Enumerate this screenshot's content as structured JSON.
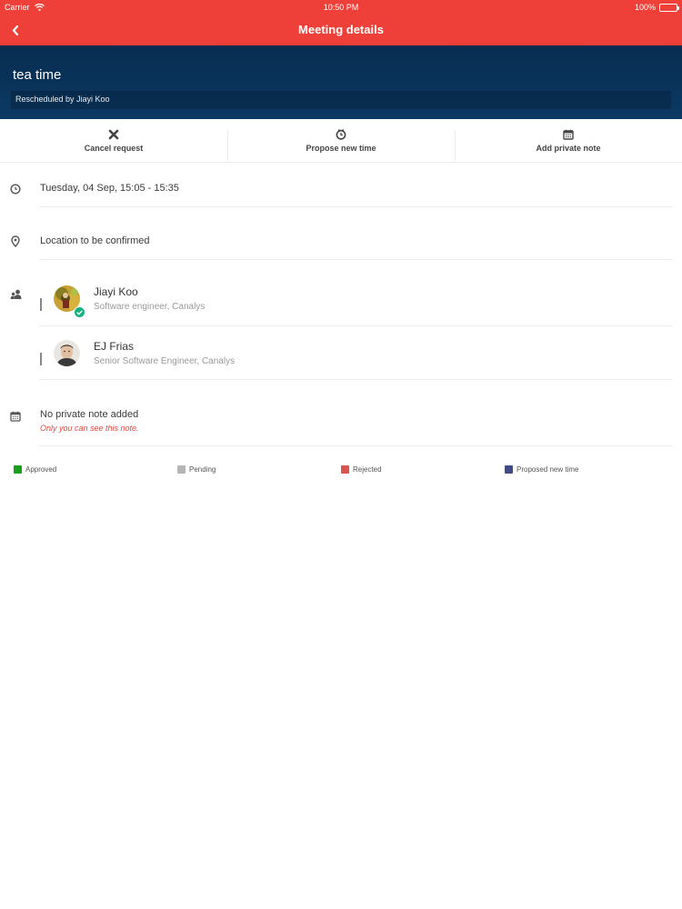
{
  "status_bar": {
    "carrier": "Carrier",
    "time": "10:50 PM",
    "battery": "100%"
  },
  "nav": {
    "title": "Meeting details"
  },
  "meeting": {
    "title": "tea time",
    "rescheduled": "Rescheduled by Jiayi Koo"
  },
  "actions": [
    {
      "label": "Cancel request",
      "icon": "close-icon"
    },
    {
      "label": "Propose new time",
      "icon": "clock-icon"
    },
    {
      "label": "Add private note",
      "icon": "calendar-icon"
    }
  ],
  "details": {
    "datetime": "Tuesday, 04 Sep, 15:05 - 15:35",
    "location": "Location to be confirmed"
  },
  "attendees": [
    {
      "name": "Jiayi Koo",
      "role": "Software engineer, Canalys",
      "status": "approved"
    },
    {
      "name": "EJ Frias",
      "role": "Senior Software Engineer, Canalys",
      "status": "none"
    }
  ],
  "note": {
    "text": "No private note added",
    "hint": "Only you can see this note."
  },
  "legend": [
    {
      "label": "Approved",
      "color": "#1a9d1a"
    },
    {
      "label": "Pending",
      "color": "#b5b5b5"
    },
    {
      "label": "Rejected",
      "color": "#d9534f"
    },
    {
      "label": "Proposed new time",
      "color": "#424a8a"
    }
  ]
}
